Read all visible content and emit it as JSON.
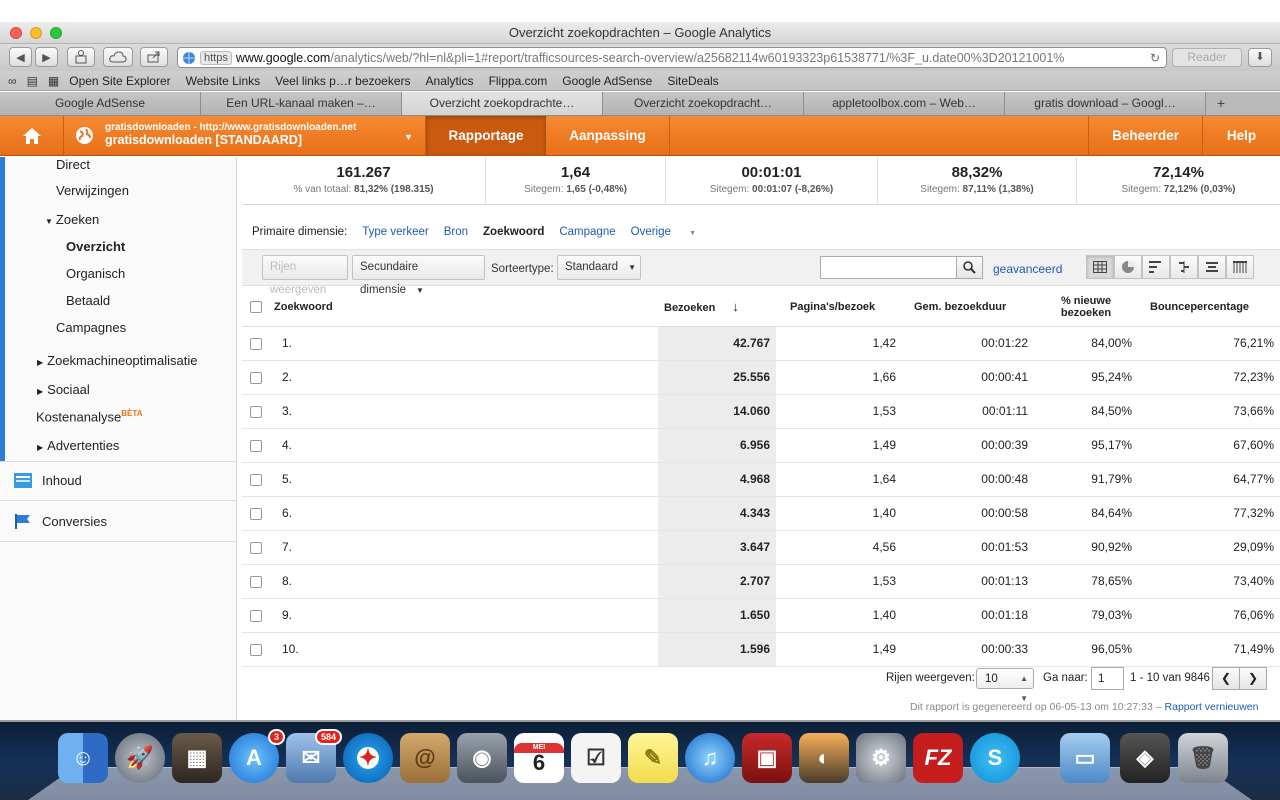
{
  "window": {
    "title": "Overzicht zoekopdrachten – Google Analytics"
  },
  "address_bar": {
    "scheme": "https",
    "domain": "www.google.com",
    "path": "/analytics/web/?hl=nl&pli=1#report/trafficsources-search-overview/a25682114w60193323p61538771/%3F_u.date00%3D20121001%",
    "reader_label": "Reader"
  },
  "bookmarks": [
    "Open Site Explorer",
    "Website Links",
    "Veel links p…r bezoekers",
    "Analytics",
    "Flippa.com",
    "Google AdSense",
    "SiteDeals"
  ],
  "browser_tabs": [
    {
      "label": "Google AdSense",
      "active": false
    },
    {
      "label": "Een URL-kanaal maken –…",
      "active": false
    },
    {
      "label": "Overzicht zoekopdrachte…",
      "active": true
    },
    {
      "label": "Overzicht zoekopdracht…",
      "active": false
    },
    {
      "label": "appletoolbox.com – Web…",
      "active": false
    },
    {
      "label": "gratis download – Googl…",
      "active": false
    }
  ],
  "ga_header": {
    "account_url": "gratisdownloaden - http://www.gratisdownloaden.net",
    "profile": "gratisdownloaden [STANDAARD]",
    "tab_reporting": "Rapportage",
    "tab_customization": "Aanpassing",
    "admin": "Beheerder",
    "help": "Help"
  },
  "sidebar": {
    "direct": "Direct",
    "referrals": "Verwijzingen",
    "search": "Zoeken",
    "overview": "Overzicht",
    "organic": "Organisch",
    "paid": "Betaald",
    "campaigns": "Campagnes",
    "seo": "Zoekmachineoptimalisatie",
    "social": "Sociaal",
    "cost": "Kostenanalyse",
    "beta": "BÈTA",
    "ads": "Advertenties",
    "content": "Inhoud",
    "conversions": "Conversies"
  },
  "metrics": [
    {
      "value": "161.267",
      "label": "% van totaal:",
      "detail": "81,32% (198.315)"
    },
    {
      "value": "1,64",
      "label": "Sitegem:",
      "detail": "1,65 (-0,48%)"
    },
    {
      "value": "00:01:01",
      "label": "Sitegem:",
      "detail": "00:01:07 (-8,26%)"
    },
    {
      "value": "88,32%",
      "label": "Sitegem:",
      "detail": "87,11% (1,38%)"
    },
    {
      "value": "72,14%",
      "label": "Sitegem:",
      "detail": "72,12% (0,03%)"
    }
  ],
  "dimensions": {
    "label": "Primaire dimensie:",
    "traffic_type": "Type verkeer",
    "source": "Bron",
    "keyword": "Zoekwoord",
    "campaign": "Campagne",
    "other": "Overige"
  },
  "controls": {
    "plot_rows": "Rijen weergeven",
    "secondary": "Secundaire dimensie",
    "sort_label": "Sorteertype:",
    "sort_value": "Standaard",
    "advanced": "geavanceerd",
    "search_value": ""
  },
  "table": {
    "columns": [
      "Zoekwoord",
      "Bezoeken",
      "Pagina's/bezoek",
      "Gem. bezoekduur",
      "% nieuwe bezoeken",
      "Bouncepercentage"
    ],
    "rows": [
      {
        "rank": "1.",
        "visits": "42.767",
        "pages": "1,42",
        "duration": "00:01:22",
        "new": "84,00%",
        "bounce": "76,21%"
      },
      {
        "rank": "2.",
        "visits": "25.556",
        "pages": "1,66",
        "duration": "00:00:41",
        "new": "95,24%",
        "bounce": "72,23%"
      },
      {
        "rank": "3.",
        "visits": "14.060",
        "pages": "1,53",
        "duration": "00:01:11",
        "new": "84,50%",
        "bounce": "73,66%"
      },
      {
        "rank": "4.",
        "visits": "6.956",
        "pages": "1,49",
        "duration": "00:00:39",
        "new": "95,17%",
        "bounce": "67,60%"
      },
      {
        "rank": "5.",
        "visits": "4.968",
        "pages": "1,64",
        "duration": "00:00:48",
        "new": "91,79%",
        "bounce": "64,77%"
      },
      {
        "rank": "6.",
        "visits": "4.343",
        "pages": "1,40",
        "duration": "00:00:58",
        "new": "84,64%",
        "bounce": "77,32%"
      },
      {
        "rank": "7.",
        "visits": "3.647",
        "pages": "4,56",
        "duration": "00:01:53",
        "new": "90,92%",
        "bounce": "29,09%"
      },
      {
        "rank": "8.",
        "visits": "2.707",
        "pages": "1,53",
        "duration": "00:01:13",
        "new": "78,65%",
        "bounce": "73,40%"
      },
      {
        "rank": "9.",
        "visits": "1.650",
        "pages": "1,40",
        "duration": "00:01:18",
        "new": "79,03%",
        "bounce": "76,06%"
      },
      {
        "rank": "10.",
        "visits": "1.596",
        "pages": "1,49",
        "duration": "00:00:33",
        "new": "96,05%",
        "bounce": "71,49%"
      }
    ]
  },
  "pager": {
    "rows_label": "Rijen weergeven:",
    "rows_value": "10",
    "goto_label": "Ga naar:",
    "goto_value": "1",
    "range": "1 - 10 van 9846"
  },
  "footer": {
    "note": "Dit rapport is gegenereerd op 06-05-13 om 10:27:33 –",
    "link": "Rapport vernieuwen"
  },
  "dock": {
    "appstore_badge": "3",
    "mail_badge": "584",
    "calendar_month": "MEI",
    "calendar_day": "6"
  }
}
